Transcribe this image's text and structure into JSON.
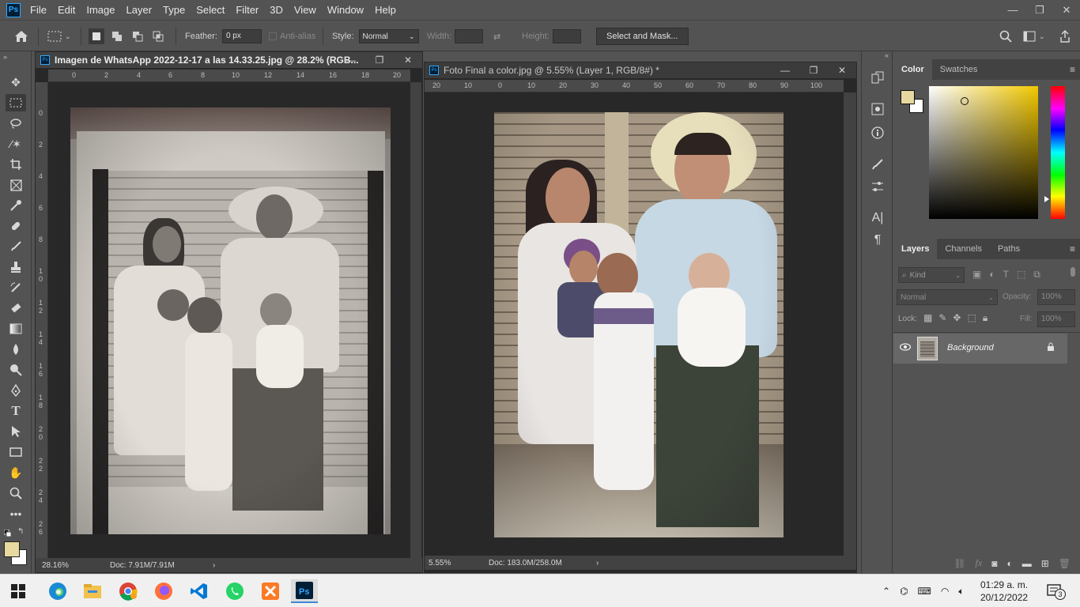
{
  "menu": [
    "File",
    "Edit",
    "Image",
    "Layer",
    "Type",
    "Select",
    "Filter",
    "3D",
    "View",
    "Window",
    "Help"
  ],
  "ps_logo": "Ps",
  "options": {
    "feather_label": "Feather:",
    "feather_value": "0 px",
    "antialias_label": "Anti-alias",
    "style_label": "Style:",
    "style_value": "Normal",
    "width_label": "Width:",
    "height_label": "Height:",
    "select_mask_label": "Select and Mask..."
  },
  "doc1": {
    "title": "Imagen de WhatsApp 2022-12-17 a las 14.33.25.jpg @ 28.2% (RGB...",
    "zoom": "28.16%",
    "doc_size": "Doc: 7.91M/7.91M",
    "ruler_h": [
      "0",
      "2",
      "4",
      "6",
      "8",
      "10",
      "12",
      "14",
      "16",
      "18",
      "20"
    ],
    "ruler_v": [
      "0",
      "2",
      "4",
      "6",
      "8",
      "1\n0",
      "1\n2",
      "1\n4",
      "1\n6",
      "1\n8",
      "2\n0",
      "2\n2",
      "2\n4",
      "2\n6"
    ]
  },
  "doc2": {
    "title": "Foto Final a color.jpg @ 5.55% (Layer 1, RGB/8#) *",
    "zoom": "5.55%",
    "doc_size": "Doc: 183.0M/258.0M",
    "ruler_h": [
      "20",
      "10",
      "0",
      "10",
      "20",
      "30",
      "40",
      "50",
      "60",
      "70",
      "80",
      "90",
      "100"
    ]
  },
  "color_panel": {
    "tabs": [
      "Color",
      "Swatches"
    ],
    "foreground": "#e8d9a0",
    "background": "#ffffff"
  },
  "layers_panel": {
    "tabs": [
      "Layers",
      "Channels",
      "Paths"
    ],
    "kind_placeholder": "Kind",
    "blend_mode": "Normal",
    "opacity_label": "Opacity:",
    "opacity_value": "100%",
    "lock_label": "Lock:",
    "fill_label": "Fill:",
    "fill_value": "100%",
    "layer_name": "Background"
  },
  "taskbar": {
    "time": "01:29 a. m.",
    "date": "20/12/2022",
    "notif_count": "3"
  }
}
